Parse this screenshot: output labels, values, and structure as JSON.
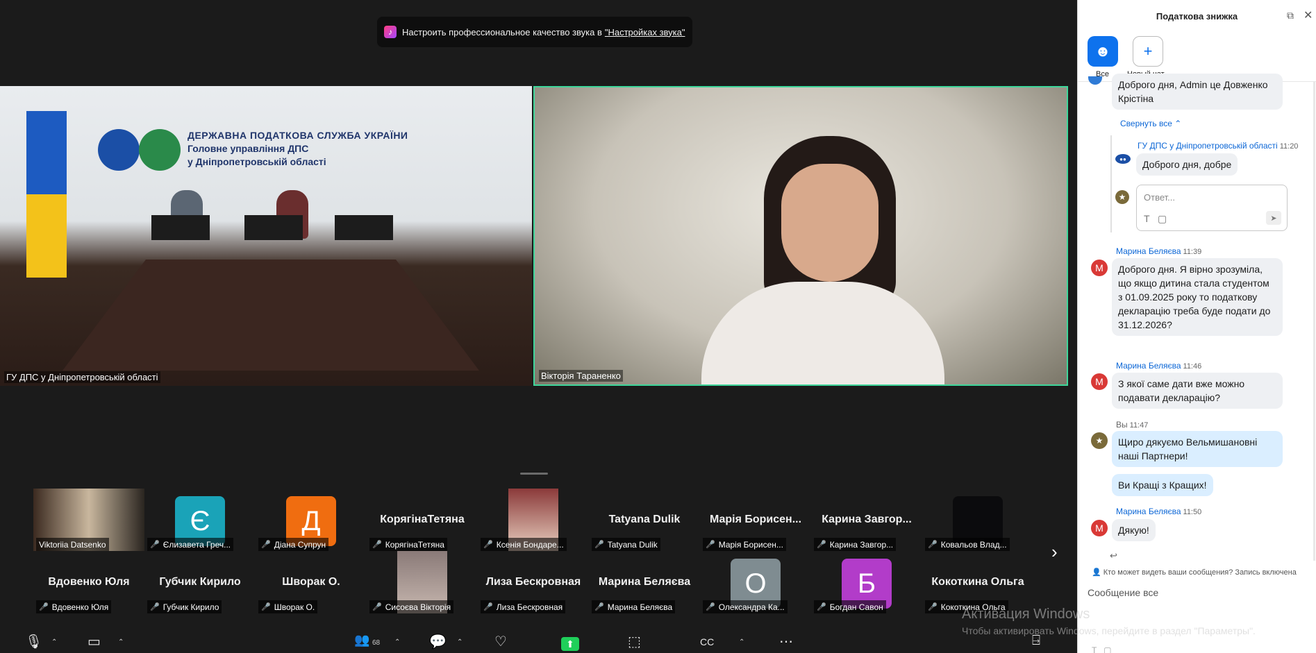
{
  "notice": {
    "text": "Настроить профессиональное качество звука в",
    "link": "\"Настройках звука\""
  },
  "videos": {
    "left": {
      "name": "ГУ ДПС у Дніпропетровській області",
      "org_line1": "ДЕРЖАВНА ПОДАТКОВА СЛУЖБА УКРАЇНИ",
      "org_line2": "Головне управління ДПС",
      "org_line3": "у Дніпропетровській області"
    },
    "right": {
      "name": "Вікторія Тараненко"
    }
  },
  "thumbnails": [
    {
      "type": "photo",
      "label": "Viktoriia Datsenko",
      "muted": false
    },
    {
      "type": "avatar",
      "initial": "Є",
      "color": "#1aa3b8",
      "label": "Єлизавета Греч...",
      "muted": true
    },
    {
      "type": "avatar",
      "initial": "Д",
      "color": "#f06d10",
      "label": "Діана Супрун",
      "muted": true
    },
    {
      "type": "name",
      "big": "КорягінаТетяна",
      "label": "КорягінаТетяна",
      "muted": true
    },
    {
      "type": "photo",
      "label": "Ксенія Бондаре...",
      "muted": true
    },
    {
      "type": "name",
      "big": "Tatyana Dulik",
      "label": "Tatyana Dulik",
      "muted": true
    },
    {
      "type": "name",
      "big": "Марія  Борисен...",
      "label": "Марія Борисен...",
      "muted": true
    },
    {
      "type": "name",
      "big": "Карина  Завгор...",
      "label": "Карина Завгор...",
      "muted": true
    },
    {
      "type": "dark",
      "label": "Ковальов Влад...",
      "muted": true
    },
    {
      "type": "name",
      "big": "Вдовенко Юля",
      "label": "Вдовенко Юля",
      "muted": true
    },
    {
      "type": "name",
      "big": "Губчик Кирило",
      "label": "Губчик Кирило",
      "muted": true
    },
    {
      "type": "name",
      "big": "Шворак О.",
      "label": "Шворак О.",
      "muted": true
    },
    {
      "type": "photo",
      "label": "Сисоєва Вікторія",
      "muted": true
    },
    {
      "type": "name",
      "big": "Лиза Бескровная",
      "label": "Лиза Бескровная",
      "muted": true
    },
    {
      "type": "name",
      "big": "Марина Беляєва",
      "label": "Марина Беляєва",
      "muted": true
    },
    {
      "type": "avatar",
      "initial": "О",
      "color": "#7f8c91",
      "label": "Олександра Ка...",
      "muted": true
    },
    {
      "type": "avatar",
      "initial": "Б",
      "color": "#b23cc9",
      "label": "Богдан Савон",
      "muted": true
    },
    {
      "type": "name",
      "big": "Кокоткина Ольга",
      "label": "Кокоткина Ольга",
      "muted": true
    }
  ],
  "toolbar": {
    "participants_count": "68"
  },
  "watermark": {
    "line1": "Активация Windows",
    "line2": "Чтобы активировать Windows, перейдите в раздел \"Параметры\"."
  },
  "chat": {
    "title": "Податкова знижка",
    "tab_all": "Все",
    "tab_new": "Новый чат",
    "top_message": "Доброго дня, Admin це Довженко Крістіна",
    "collapse": "Свернуть все",
    "thread_reply": {
      "sender": "ГУ ДПС у Дніпропетровській області",
      "time": "11:20",
      "text": "Доброго дня, добре"
    },
    "reply_placeholder": "Ответ...",
    "messages": [
      {
        "sender": "Марина Беляєва",
        "time": "11:39",
        "text": "Доброго дня. Я вірно зрозуміла, що якщо дитина стала студентом з 01.09.2025 року то податкову декларацію треба буде подати до 31.12.2026?"
      },
      {
        "sender": "Марина Беляєва",
        "time": "11:46",
        "text": "З якої саме дати вже можно подавати декларацію?"
      },
      {
        "sender": "Вы",
        "time": "11:47",
        "text": "Щиро дякуємо Вельмишановні наші Партнери!"
      },
      {
        "text": "Ви Кращі з Кращих!"
      },
      {
        "sender": "Марина Беляєва",
        "time": "11:50",
        "text": "Дякую!"
      }
    ],
    "privacy": "Кто может видеть ваши сообщения? Запись включена",
    "input_placeholder": "Сообщение все"
  }
}
